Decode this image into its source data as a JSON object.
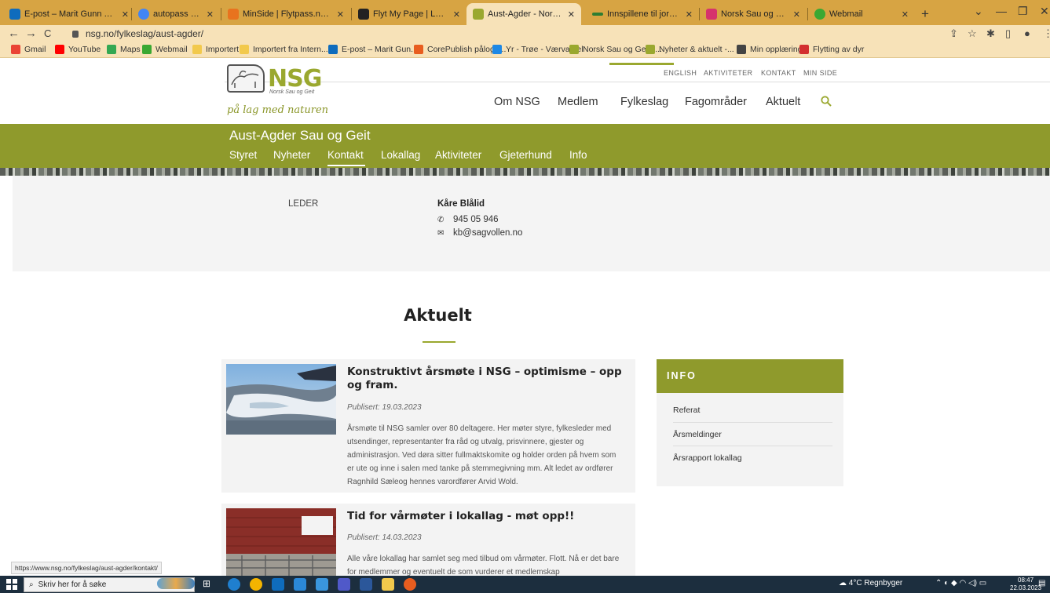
{
  "browser": {
    "tabs": [
      {
        "title": "E-post – Marit Gunn Tveit",
        "color": "#0f6cbd"
      },
      {
        "title": "autopass brikke - Google",
        "color": "#4285f4"
      },
      {
        "title": "MinSide | Flytpass.no | Flyt",
        "color": "#e8731e"
      },
      {
        "title": "Flyt My Page | Login",
        "color": "#222222"
      },
      {
        "title": "Aust-Agder - Norsk Sau og",
        "color": "#9aa82f"
      },
      {
        "title": "Innspillene til jordbruksfor",
        "color": "#2e7d32"
      },
      {
        "title": "Norsk Sau og geit på Insta",
        "color": "#d6336c"
      },
      {
        "title": "Webmail",
        "color": "#3aa832"
      }
    ],
    "url": "nsg.no/fylkeslag/aust-agder/",
    "bookmarks": [
      {
        "label": "Gmail",
        "color": "#ea4335"
      },
      {
        "label": "YouTube",
        "color": "#ff0000"
      },
      {
        "label": "Maps",
        "color": "#34a853"
      },
      {
        "label": "Webmail",
        "color": "#3aa832"
      },
      {
        "label": "Importert",
        "color": "#f2c94c"
      },
      {
        "label": "Importert fra Intern...",
        "color": "#f2c94c"
      },
      {
        "label": "E-post – Marit Gun...",
        "color": "#0f6cbd"
      },
      {
        "label": "CorePublish pålogg...",
        "color": "#e85d1f"
      },
      {
        "label": "Yr - Trøe - Værvarsel",
        "color": "#1e88e5"
      },
      {
        "label": "Norsk Sau og Geit -...",
        "color": "#9aa82f"
      },
      {
        "label": "Nyheter & aktuelt -...",
        "color": "#9aa82f"
      },
      {
        "label": "Min opplæring",
        "color": "#444444"
      },
      {
        "label": "Flytting av dyr",
        "color": "#d32f2f"
      }
    ],
    "status_url": "https://www.nsg.no/fylkeslag/aust-agder/kontakt/"
  },
  "site": {
    "utility_links": [
      "ENGLISH",
      "AKTIVITETER",
      "KONTAKT",
      "MIN SIDE"
    ],
    "logo_text": "NSG",
    "logo_sub": "Norsk Sau og Geit",
    "slogan": "på lag med naturen",
    "main_nav": [
      "Om NSG",
      "Medlem",
      "Fylkeslag",
      "Fagområder",
      "Aktuelt"
    ],
    "accent": "#8f9a2c",
    "county_title": "Aust-Agder Sau og Geit",
    "sub_nav": [
      "Styret",
      "Nyheter",
      "Kontakt",
      "Lokallag",
      "Aktiviteter",
      "Gjeterhund",
      "Info"
    ]
  },
  "contact": {
    "role": "LEDER",
    "name": "Kåre Blålid",
    "phone": "945 05 946",
    "email": "kb@sagvollen.no",
    "phone_icon": "phone-icon",
    "email_icon": "envelope-icon"
  },
  "aktuelt": {
    "heading": "Aktuelt",
    "articles": [
      {
        "title": "Konstruktivt årsmøte i NSG – optimisme – opp og fram.",
        "published": "Publisert: 19.03.2023",
        "excerpt": "Årsmøte til NSG samler over 80 deltagere. Her møter styre, fylkesleder med utsendinger, representanter fra råd og utvalg, prisvinnere, gjester og administrasjon. Ved døra sitter fullmaktskomite og holder orden på hvem som er ute og inne i salen med tanke på stemmegivning mm. Alt ledet av ordfører Ragnhild Sæleog hennes varordfører Arvid Wold."
      },
      {
        "title": "Tid for vårmøter i lokallag - møt opp!!",
        "published": "Publisert: 14.03.2023",
        "excerpt": "Alle våre lokallag har samlet seg med tilbud om vårmøter. Flott. Nå er det bare for medlemmer og eventuelt de som vurderer et medlemskap"
      }
    ]
  },
  "info": {
    "heading": "INFO",
    "items": [
      "Referat",
      "Årsmeldinger",
      "Årsrapport lokallag"
    ]
  },
  "taskbar": {
    "search_placeholder": "Skriv her for å søke",
    "weather": "4°C  Regnbyger",
    "time": "08:47",
    "date": "22.03.2023"
  }
}
